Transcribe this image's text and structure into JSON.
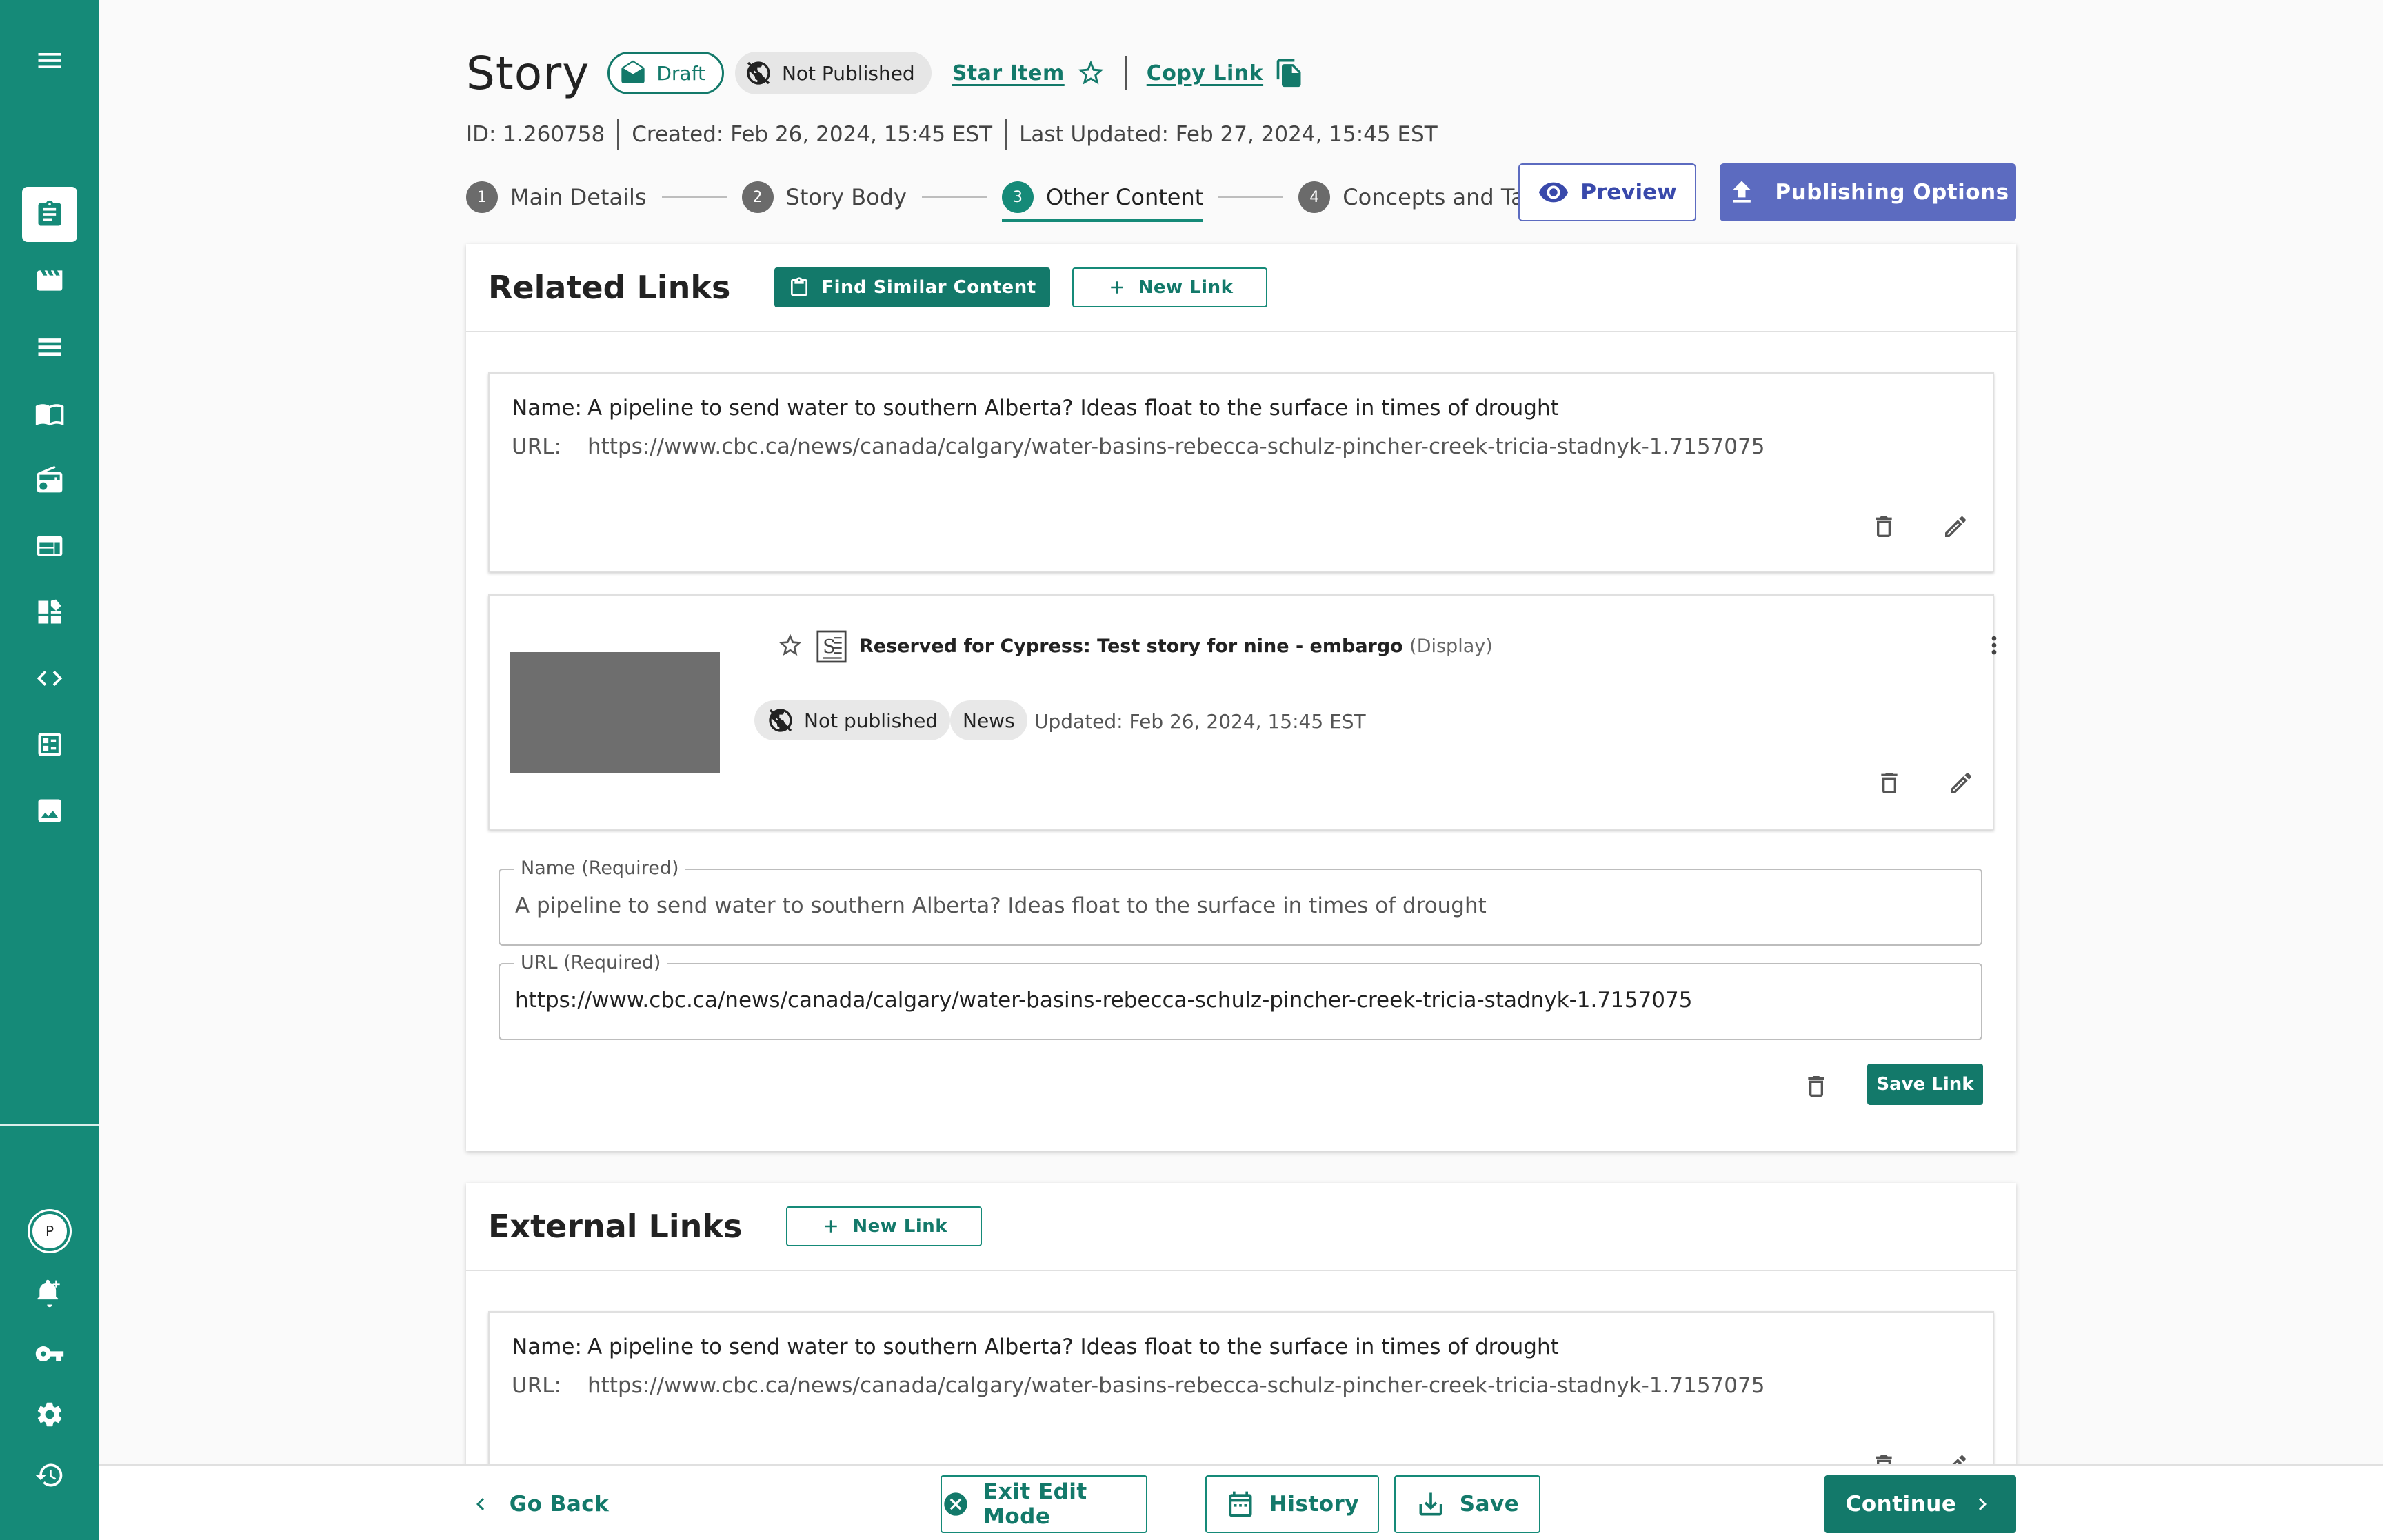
{
  "sidebar": {
    "icons": [
      "menu-icon",
      "story-icon",
      "video-icon",
      "list-icon",
      "book-icon",
      "radio-icon",
      "layout-icon",
      "dashboard-icon",
      "code-icon",
      "checklist-icon",
      "image-icon"
    ],
    "avatar_letter": "P",
    "bottom_icons": [
      "notification-add-icon",
      "key-icon",
      "gear-icon",
      "history-icon"
    ]
  },
  "header": {
    "title": "Story",
    "draft_label": "Draft",
    "not_published_label": "Not Published",
    "star_label": "Star Item",
    "copy_label": "Copy Link",
    "id": "ID: 1.260758",
    "created": "Created: Feb 26, 2024, 15:45 EST",
    "updated": "Last Updated: Feb 27, 2024, 15:45 EST"
  },
  "stepper": {
    "steps": [
      {
        "num": "1",
        "label": "Main Details"
      },
      {
        "num": "2",
        "label": "Story Body"
      },
      {
        "num": "3",
        "label": "Other Content"
      },
      {
        "num": "4",
        "label": "Concepts and Tags"
      }
    ],
    "active": 3
  },
  "actions": {
    "preview": "Preview",
    "publishing_options": "Publishing Options"
  },
  "related": {
    "title": "Related Links",
    "find_similar": "Find Similar Content",
    "new_link": "New Link",
    "link1": {
      "name_key": "Name:",
      "name": "A pipeline to send water to southern Alberta? Ideas float to the surface in times of drought",
      "url_key": "URL:",
      "url": "https://www.cbc.ca/news/canada/calgary/water-basins-rebecca-schulz-pincher-creek-tricia-stadnyk-1.7157075"
    },
    "item": {
      "title": "Reserved for Cypress: Test story for nine - embargo",
      "type": "(Display)",
      "status": "Not published",
      "section": "News",
      "updated": "Updated: Feb 26, 2024, 15:45 EST"
    },
    "form": {
      "name_label": "Name (Required)",
      "name_value": "A pipeline to send water to southern Alberta? Ideas float to the surface in times of drought",
      "url_label": "URL (Required)",
      "url_value": "https://www.cbc.ca/news/canada/calgary/water-basins-rebecca-schulz-pincher-creek-tricia-stadnyk-1.7157075",
      "save_label": "Save Link"
    }
  },
  "external": {
    "title": "External Links",
    "new_link": "New Link",
    "link1": {
      "name_key": "Name:",
      "name": "A pipeline to send water to southern Alberta? Ideas float to the surface in times of drought",
      "url_key": "URL:",
      "url": "https://www.cbc.ca/news/canada/calgary/water-basins-rebecca-schulz-pincher-creek-tricia-stadnyk-1.7157075"
    }
  },
  "footer": {
    "go_back": "Go Back",
    "exit_edit": "Exit Edit Mode",
    "history": "History",
    "save": "Save",
    "continue": "Continue"
  },
  "colors": {
    "brand": "#158a78",
    "brand_dark": "#13796a",
    "accent": "#5c6bc0"
  }
}
